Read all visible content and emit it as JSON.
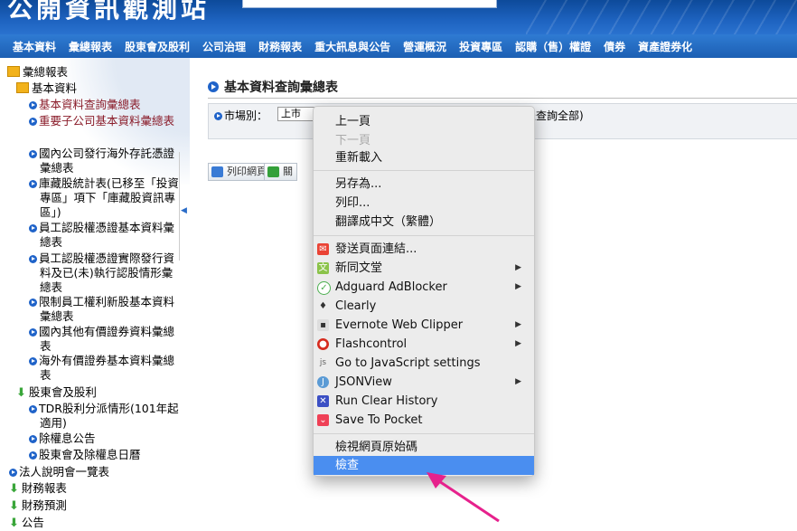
{
  "header": {
    "logo_text": "公開資訊觀測站"
  },
  "nav": {
    "items": [
      "基本資料",
      "彙總報表",
      "股東會及股利",
      "公司治理",
      "財務報表",
      "重大訊息與公告",
      "營運概況",
      "投資專區",
      "認購（售）權證",
      "債券",
      "資產證券化"
    ]
  },
  "sidebar": {
    "root": "彙總報表",
    "group1": "基本資料",
    "items": [
      "基本資料查詢彙總表",
      "重要子公司基本資料彙總表",
      "國內公司發行海外存託憑證彙總表",
      "庫藏股統計表(已移至「投資專區」項下「庫藏股資訊專區」)",
      "員工認股權憑證基本資料彙總表",
      "員工認股權憑證實際發行資料及已(未)執行認股情形彙總表",
      "限制員工權利新股基本資料彙總表",
      "國內其他有價證券資料彙總表",
      "海外有價證券基本資料彙總表"
    ],
    "group2": "股東會及股利",
    "group2_items": [
      "TDR股利分派情形(101年起適用)",
      "除權息公告",
      "股東會及除權息日曆"
    ],
    "bottom": [
      "法人說明會一覽表",
      "財務報表",
      "財務預測",
      "公告"
    ]
  },
  "main": {
    "title": "基本資料查詢彙總表",
    "market_label": "市場別：",
    "market_value": "上市",
    "filter_note": "表查詢全部)",
    "print_btn": "列印網頁",
    "close_btn": "關"
  },
  "menu": {
    "group1": [
      "上一頁",
      "下一頁",
      "重新載入"
    ],
    "group2": [
      "另存為...",
      "列印...",
      "翻譯成中文（繁體）"
    ],
    "group3": [
      "發送頁面連結...",
      "新同文堂",
      "Adguard AdBlocker",
      "Clearly",
      "Evernote Web Clipper",
      "Flashcontrol",
      "Go to JavaScript settings",
      "JSONView",
      "Run Clear History",
      "Save To Pocket"
    ],
    "group4": [
      "檢視網頁原始碼",
      "檢查"
    ]
  },
  "colors": {
    "accent": "#1f63c9",
    "menu_highlight": "#4a8ef0",
    "arrow": "#e6218c"
  }
}
